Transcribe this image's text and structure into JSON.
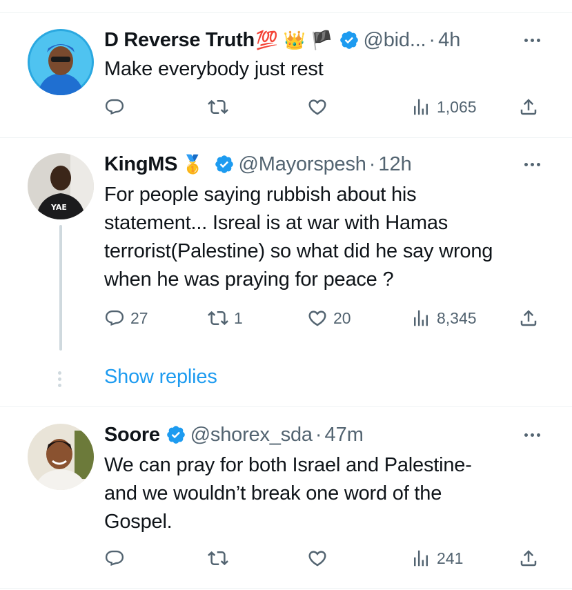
{
  "tweets": [
    {
      "name": "D Reverse Truth",
      "emojis": "💯 👑 🏴",
      "handle": "@bid...",
      "separator": "·",
      "time": "4h",
      "text": [
        "Make everybody just rest"
      ],
      "replies": "",
      "retweets": "",
      "likes": "",
      "views": "1,065"
    },
    {
      "name": "KingMS",
      "emojis": "🥇",
      "handle": "@Mayorspesh",
      "separator": "·",
      "time": "12h",
      "text": [
        "For people saying rubbish about his",
        "statement... Isreal is at war with Hamas",
        "terrorist(Palestine) so what did he say wrong",
        "when he was praying for peace ?"
      ],
      "replies": "27",
      "retweets": "1",
      "likes": "20",
      "views": "8,345"
    },
    {
      "name": "Soore",
      "emojis": "",
      "handle": "@shorex_sda",
      "separator": "·",
      "time": "47m",
      "text": [
        "We can pray for both Israel and Palestine-",
        "and we wouldn’t break one word of the",
        "Gospel."
      ],
      "replies": "",
      "retweets": "",
      "likes": "",
      "views": "241"
    }
  ],
  "show_replies": "Show replies",
  "colors": {
    "accent": "#1d9bf0",
    "muted": "#536471",
    "text": "#0f1419",
    "divider": "#eff3f4"
  },
  "icons": [
    "reply-icon",
    "retweet-icon",
    "like-icon",
    "views-icon",
    "share-icon",
    "verified-badge-icon",
    "more-icon"
  ]
}
